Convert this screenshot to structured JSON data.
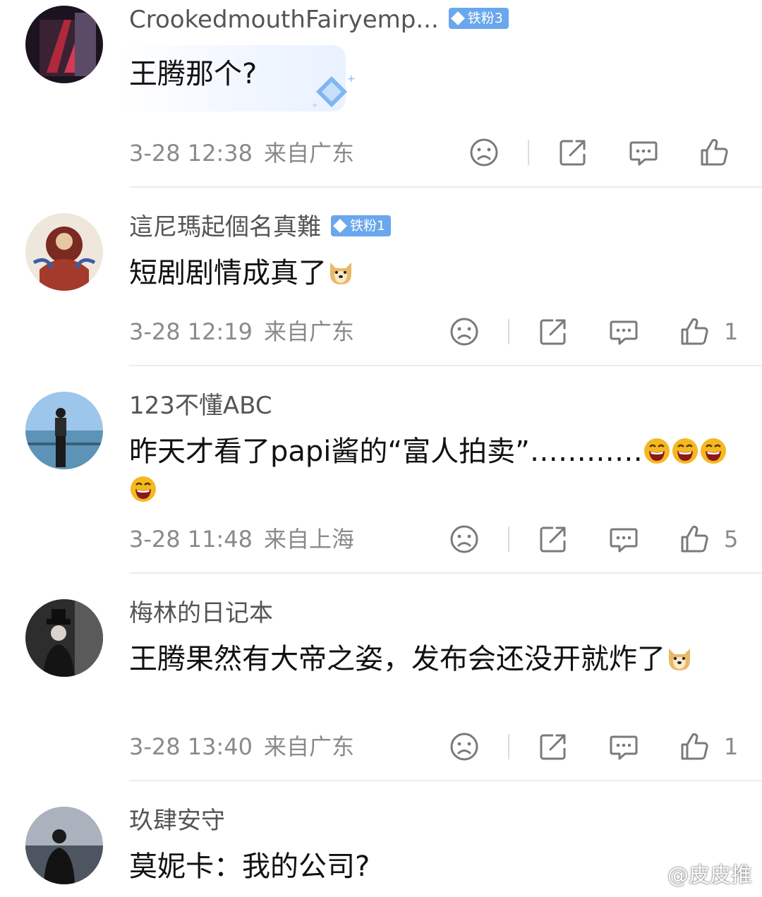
{
  "comments": [
    {
      "username": "CrookedmouthFairyemp...",
      "badge": "铁粉3",
      "text": "王腾那个?",
      "emojis": [],
      "time": "3-28 12:38",
      "location": "来自广东",
      "likes": ""
    },
    {
      "username": "這尼瑪起個名真難",
      "badge": "铁粉1",
      "text": "短剧剧情成真了",
      "emojis": [
        "doge"
      ],
      "time": "3-28 12:19",
      "location": "来自广东",
      "likes": "1"
    },
    {
      "username": "123不懂ABC",
      "badge": "",
      "text": "昨天才看了papi酱的“富人拍卖”…………",
      "emojis": [
        "laugh",
        "laugh",
        "laugh",
        "laugh"
      ],
      "time": "3-28 11:48",
      "location": "来自上海",
      "likes": "5"
    },
    {
      "username": "梅林的日记本",
      "badge": "",
      "text": "王腾果然有大帝之姿，发布会还没开就炸了",
      "emojis": [
        "doge"
      ],
      "time": "3-28 13:40",
      "location": "来自广东",
      "likes": "1"
    },
    {
      "username": "玖肆安守",
      "badge": "",
      "text": "莫妮卡：我的公司?",
      "emojis": [],
      "time": "",
      "location": "",
      "likes": ""
    }
  ],
  "icons": {
    "dislike": "sad-face-icon",
    "share": "share-icon",
    "comment": "comment-bubble-icon",
    "like": "thumbs-up-icon"
  },
  "colors": {
    "badge": "#6aa7ec",
    "meta_text": "#8a8a8a",
    "icon_stroke": "#7a7a7a"
  },
  "watermark": "@皮皮推"
}
